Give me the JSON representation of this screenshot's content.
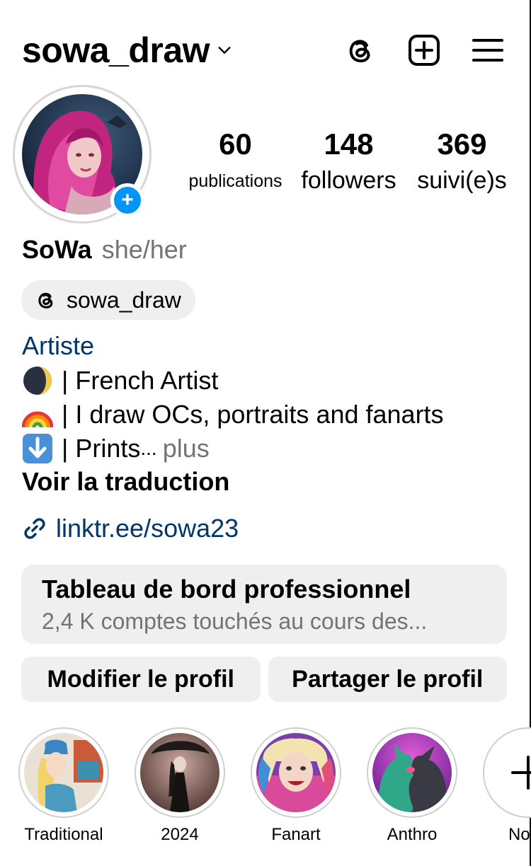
{
  "header": {
    "username": "sowa_draw",
    "icons": [
      "chevron-down-icon",
      "threads-icon",
      "new-post-icon",
      "menu-icon"
    ]
  },
  "profile": {
    "stats": [
      {
        "value": "60",
        "label": "publications"
      },
      {
        "value": "148",
        "label": "followers"
      },
      {
        "value": "369",
        "label": "suivi(e)s"
      }
    ],
    "add_story_symbol": "+",
    "name": "SoWa",
    "pronouns": "she/her",
    "threads_handle": "sowa_draw",
    "category": "Artiste",
    "bio": [
      {
        "emoji": "moon-emoji",
        "text": "| French Artist"
      },
      {
        "emoji": "rainbow-emoji",
        "text": "| I draw OCs, portraits and fanarts"
      },
      {
        "emoji": "down-arrow-emoji",
        "text": "| Prints"
      }
    ],
    "ellipsis": "...",
    "more_label": "plus",
    "translate_label": "Voir la traduction",
    "link": "linktr.ee/sowa23"
  },
  "dashboard": {
    "title": "Tableau de bord professionnel",
    "subtitle": "2,4 K comptes touchés au cours des..."
  },
  "actions": {
    "edit_label": "Modifier le profil",
    "share_label": "Partager le profil"
  },
  "highlights": [
    {
      "label": "Traditional"
    },
    {
      "label": "2024"
    },
    {
      "label": "Fanart"
    },
    {
      "label": "Anthro"
    },
    {
      "label": "Nouv"
    }
  ],
  "colors": {
    "accent_blue": "#0095f6",
    "link_blue": "#00376b",
    "muted_gray": "#737373",
    "chip_gray": "#efefef"
  }
}
